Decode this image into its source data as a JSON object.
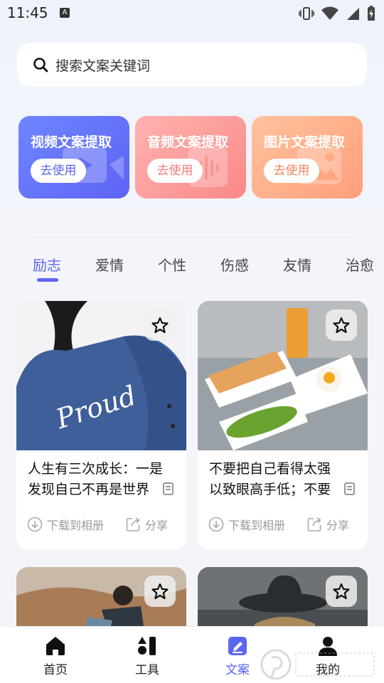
{
  "status_bar": {
    "time": "11:45",
    "notification_badge": "A"
  },
  "search": {
    "placeholder": "搜索文案关键词"
  },
  "tools": [
    {
      "title": "视频文案提取",
      "button": "去使用",
      "color": "#5e63f4"
    },
    {
      "title": "音频文案提取",
      "button": "去使用",
      "color": "#f98988"
    },
    {
      "title": "图片文案提取",
      "button": "去使用",
      "color": "#ff9f7a"
    }
  ],
  "tabs": [
    {
      "label": "励志",
      "active": true
    },
    {
      "label": "爱情",
      "active": false
    },
    {
      "label": "个性",
      "active": false
    },
    {
      "label": "伤感",
      "active": false
    },
    {
      "label": "友情",
      "active": false
    },
    {
      "label": "治愈",
      "active": false
    }
  ],
  "cards": [
    {
      "line1": "人生有三次成长：一是",
      "line2": "发现自己不再是世界",
      "download": "下载到相册",
      "share": "分享",
      "image": "Proud"
    },
    {
      "line1": "不要把自己看得太强",
      "line2": "以致眼高手低；不要",
      "download": "下载到相册",
      "share": "分享",
      "image": ""
    },
    {
      "line1": "",
      "line2": "",
      "download": "",
      "share": "",
      "image": ""
    },
    {
      "line1": "",
      "line2": "",
      "download": "",
      "share": "",
      "image": ""
    }
  ],
  "bottom_nav": [
    {
      "label": "首页",
      "icon": "home-icon",
      "active": false
    },
    {
      "label": "工具",
      "icon": "tools-icon",
      "active": false
    },
    {
      "label": "文案",
      "icon": "edit-icon",
      "active": true
    },
    {
      "label": "我的",
      "icon": "user-icon",
      "active": false
    }
  ],
  "accent_color": "#5b66f0"
}
